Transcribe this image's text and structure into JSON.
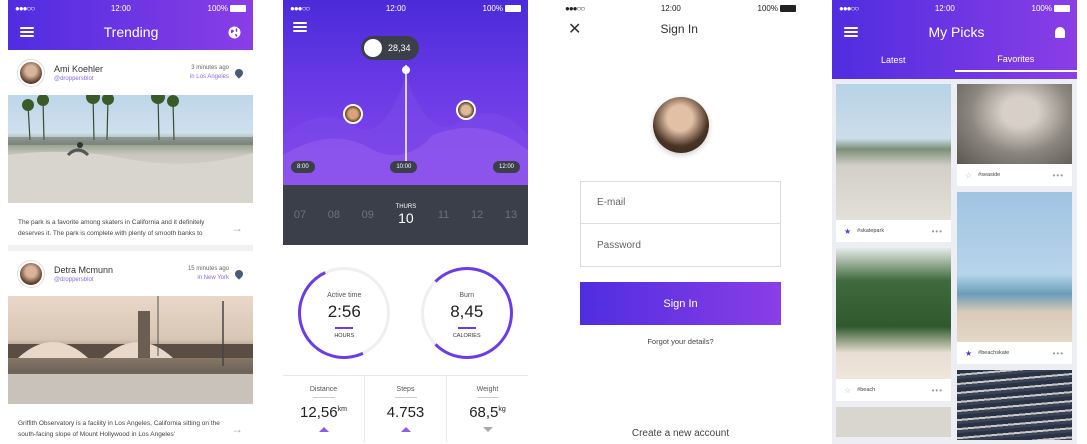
{
  "status": {
    "carrier": "●●●○○",
    "time": "12:00",
    "battery": "100%"
  },
  "trending": {
    "title": "Trending",
    "posts": [
      {
        "name": "Ami Koehler",
        "handle": "@droppersblot",
        "time": "3 minutes ago",
        "location": "in Los Angeles",
        "caption": "The park is a favorite among skaters in California and it definitely deserves it. The park is complete with plenty of smooth banks to"
      },
      {
        "name": "Detra Mcmunn",
        "handle": "@droppersblot",
        "time": "15 minutes ago",
        "location": "in New York",
        "caption": "Griffith Observatory is a facility in Los Angeles, California sitting on the south-facing slope of Mount Hollywood in Los Angeles'"
      }
    ]
  },
  "activity": {
    "bubble_value": "28,34",
    "timeline": {
      "start": "8:00",
      "current": "10:00",
      "end": "12:00"
    },
    "days": [
      {
        "num": "07",
        "name": ""
      },
      {
        "num": "08",
        "name": ""
      },
      {
        "num": "09",
        "name": ""
      },
      {
        "num": "10",
        "name": "THURS"
      },
      {
        "num": "11",
        "name": ""
      },
      {
        "num": "12",
        "name": ""
      },
      {
        "num": "13",
        "name": ""
      }
    ],
    "rings": [
      {
        "label": "Active time",
        "value": "2:56",
        "unit": "HOURS"
      },
      {
        "label": "Burn",
        "value": "8,45",
        "unit": "CALORIES"
      }
    ],
    "stats": [
      {
        "label": "Distance",
        "value": "12,56",
        "unit": "km"
      },
      {
        "label": "Steps",
        "value": "4.753",
        "unit": ""
      },
      {
        "label": "Weight",
        "value": "68,5",
        "unit": "kg"
      }
    ]
  },
  "signin": {
    "title": "Sign In",
    "email_placeholder": "E-mail",
    "password_placeholder": "Password",
    "button": "Sign In",
    "forgot": "Forgot your details?",
    "create": "Create a new account"
  },
  "picks": {
    "title": "My Picks",
    "tabs": [
      "Latest",
      "Favorites"
    ],
    "cards": [
      {
        "tag": "#skatepark",
        "favorite": true
      },
      {
        "tag": "#beach",
        "favorite": false
      },
      {
        "tag": "#seaside",
        "favorite": false
      },
      {
        "tag": "#beachskate",
        "favorite": true
      }
    ]
  },
  "colors": {
    "accent": "#5a35e3",
    "gradient_start": "#4f2de0",
    "gradient_end": "#8a3ee6"
  }
}
